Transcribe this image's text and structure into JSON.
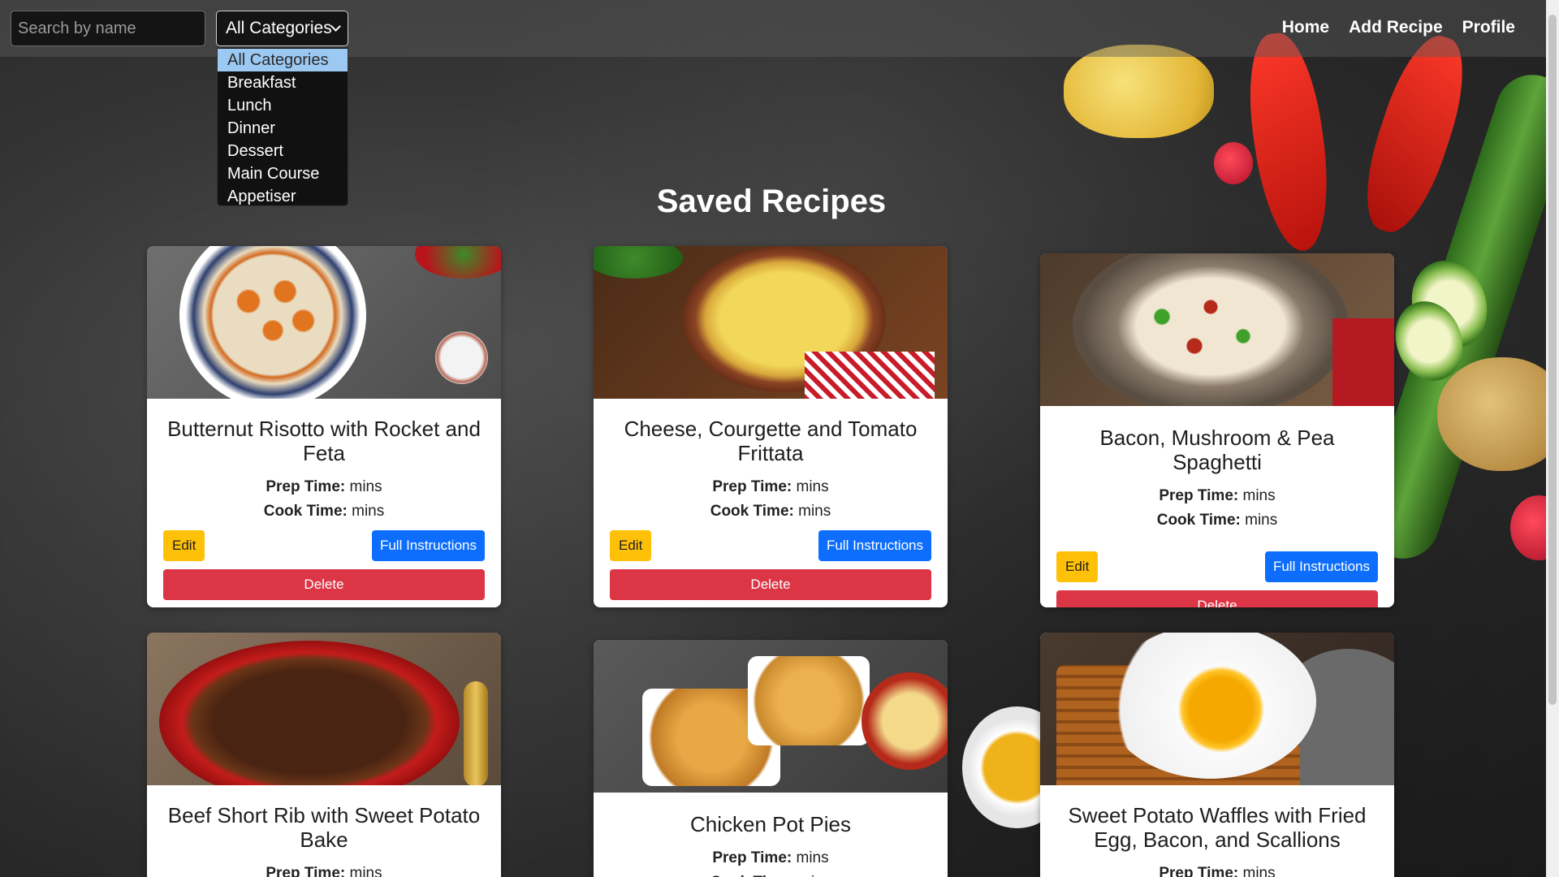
{
  "search": {
    "placeholder": "Search by name"
  },
  "category_filter": {
    "selected": "All Categories",
    "options": [
      "All Categories",
      "Breakfast",
      "Lunch",
      "Dinner",
      "Dessert",
      "Main Course",
      "Appetiser"
    ]
  },
  "nav": {
    "links": [
      "Home",
      "Add Recipe",
      "Profile"
    ]
  },
  "page": {
    "title": "Saved Recipes"
  },
  "labels": {
    "prep_time": "Prep Time:",
    "cook_time": "Cook Time:",
    "time_unit": "mins",
    "edit": "Edit",
    "full_instructions": "Full Instructions",
    "delete": "Delete"
  },
  "recipes": [
    {
      "title": "Butternut Risotto with Rocket and Feta"
    },
    {
      "title": "Cheese, Courgette and Tomato Frittata"
    },
    {
      "title": "Bacon, Mushroom & Pea Spaghetti"
    },
    {
      "title": "Beef Short Rib with Sweet Potato Bake"
    },
    {
      "title": "Chicken Pot Pies"
    },
    {
      "title": "Sweet Potato Waffles with Fried Egg, Bacon, and Scallions"
    }
  ],
  "colors": {
    "edit_button": "#ffc107",
    "instructions_button": "#0d6efd",
    "delete_button": "#dc3545",
    "dropdown_highlight": "#9cc9f2"
  }
}
